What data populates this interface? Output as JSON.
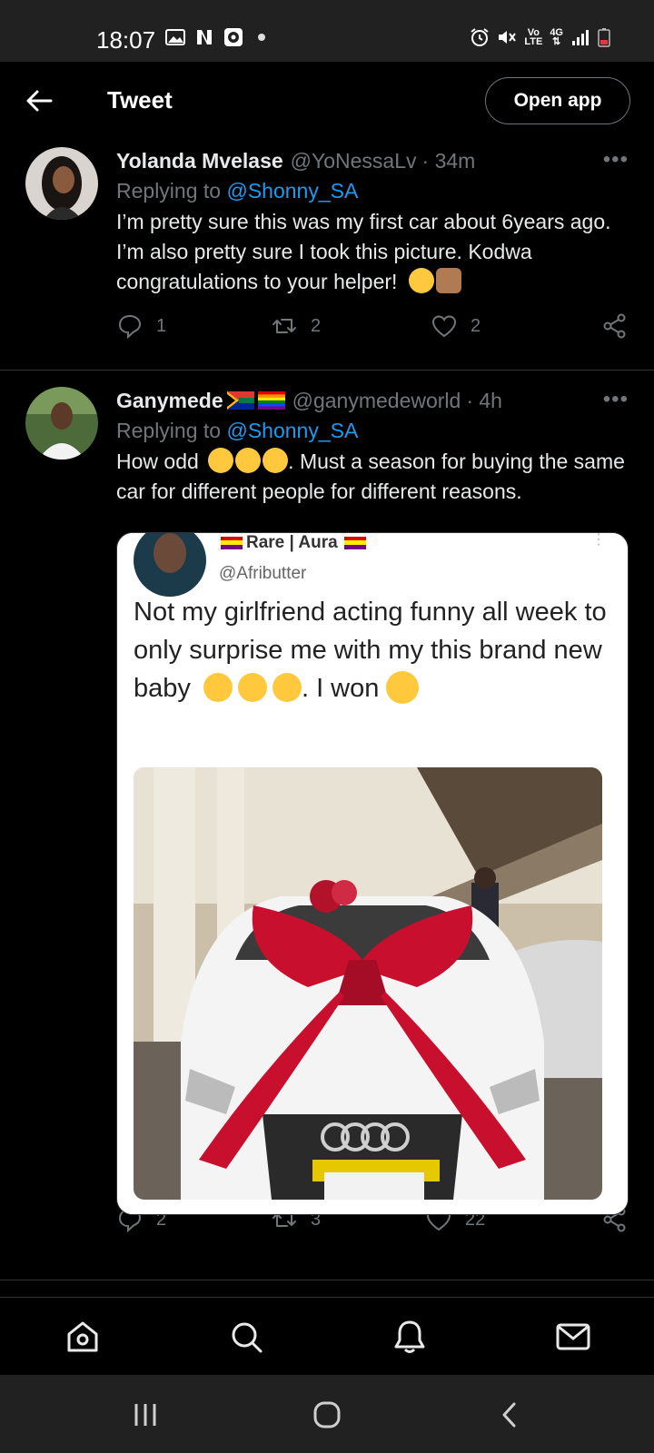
{
  "status_bar": {
    "time": "18:07",
    "net_label_top": "Vo",
    "net_label_bottom": "LTE",
    "net_4g": "4G"
  },
  "header": {
    "title": "Tweet",
    "open_app_label": "Open app"
  },
  "tweets": [
    {
      "name": "Yolanda Mvelase",
      "handle": "@YoNessaLv",
      "time": "· 34m",
      "replying_prefix": "Replying to",
      "replying_to": "@Shonny_SA",
      "text": "I’m pretty sure this was my first car about 6years ago. I’m also pretty sure I took this picture. Kodwa congratulations to your helper!",
      "replies": "1",
      "retweets": "2",
      "likes": "2"
    },
    {
      "name": "Ganymede",
      "handle": "@ganymedeworld",
      "time": "· 4h",
      "replying_prefix": "Replying to",
      "replying_to": "@Shonny_SA",
      "text_before": "How odd",
      "text_after": ". Must a season for buying the same car for different people for different reasons.",
      "replies": "2",
      "retweets": "3",
      "likes": "22"
    }
  ],
  "embedded_screenshot": {
    "author": "Rare | Aura",
    "handle": "@Afributter",
    "text": "Not my girlfriend acting funny all week to only surprise me with my this brand new baby",
    "text_tail": ". I won"
  },
  "icons": {
    "back": "back-arrow-icon",
    "reply": "reply-icon",
    "retweet": "retweet-icon",
    "like": "heart-icon",
    "share": "share-icon",
    "home": "home-icon",
    "search": "search-icon",
    "notifications": "bell-icon",
    "messages": "mail-icon"
  },
  "colors": {
    "background": "#000000",
    "link": "#1d9bf0",
    "muted": "#71767b",
    "text": "#e7e9ea",
    "divider": "#2f3336"
  }
}
